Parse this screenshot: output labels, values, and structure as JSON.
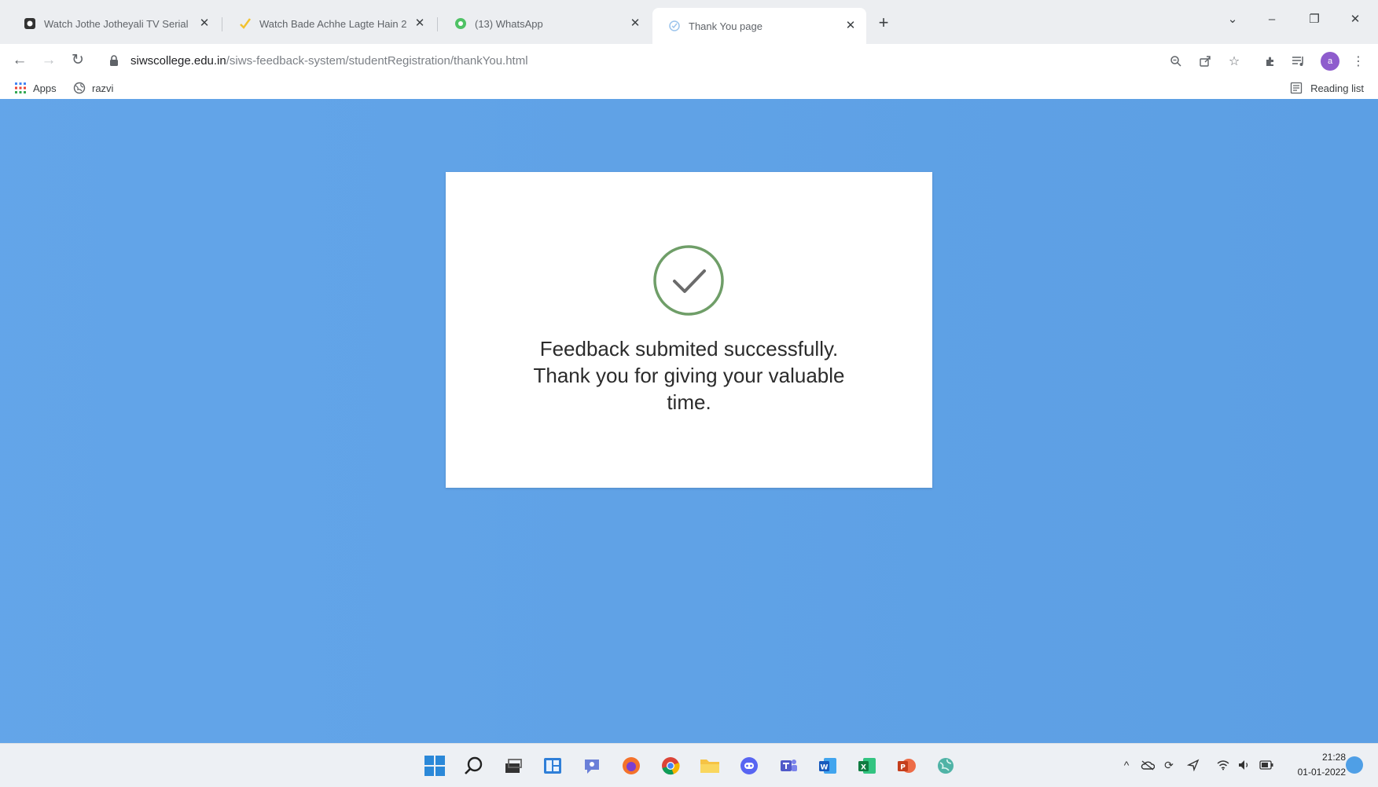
{
  "browser": {
    "tabs": [
      {
        "title": "Watch Jothe Jotheyali TV Serial",
        "favicon": "hotstar-icon",
        "active": false
      },
      {
        "title": "Watch Bade Achhe Lagte Hain 2",
        "favicon": "checkmark-logo-icon",
        "active": false
      },
      {
        "title": "(13) WhatsApp",
        "favicon": "whatsapp-icon",
        "active": false
      },
      {
        "title": "Thank You page",
        "favicon": "page-icon",
        "active": true
      }
    ],
    "address_bar": {
      "host": "siwscollege.edu.in",
      "path": "/siws-feedback-system/studentRegistration/thankYou.html"
    },
    "bookmarks": [
      {
        "label": "Apps",
        "icon": "apps-grid-icon"
      },
      {
        "label": "razvi",
        "icon": "globe-icon"
      }
    ],
    "reading_list_label": "Reading list",
    "avatar_letter": "a"
  },
  "page": {
    "background_color": "#5ea2e8",
    "status_icon": "check-circle-icon",
    "message_line1": "Feedback submited successfully.",
    "message_line2": "Thank you for giving your valuable",
    "message_line3": "time."
  },
  "taskbar": {
    "apps": [
      "windows-start-icon",
      "search-icon",
      "task-view-icon",
      "widgets-icon",
      "chat-icon",
      "firefox-icon",
      "chrome-icon",
      "file-explorer-icon",
      "discord-icon",
      "teams-icon",
      "word-icon",
      "excel-icon",
      "powerpoint-icon",
      "vpn-globe-icon"
    ],
    "time": "21:28",
    "date": "01-01-2022"
  }
}
